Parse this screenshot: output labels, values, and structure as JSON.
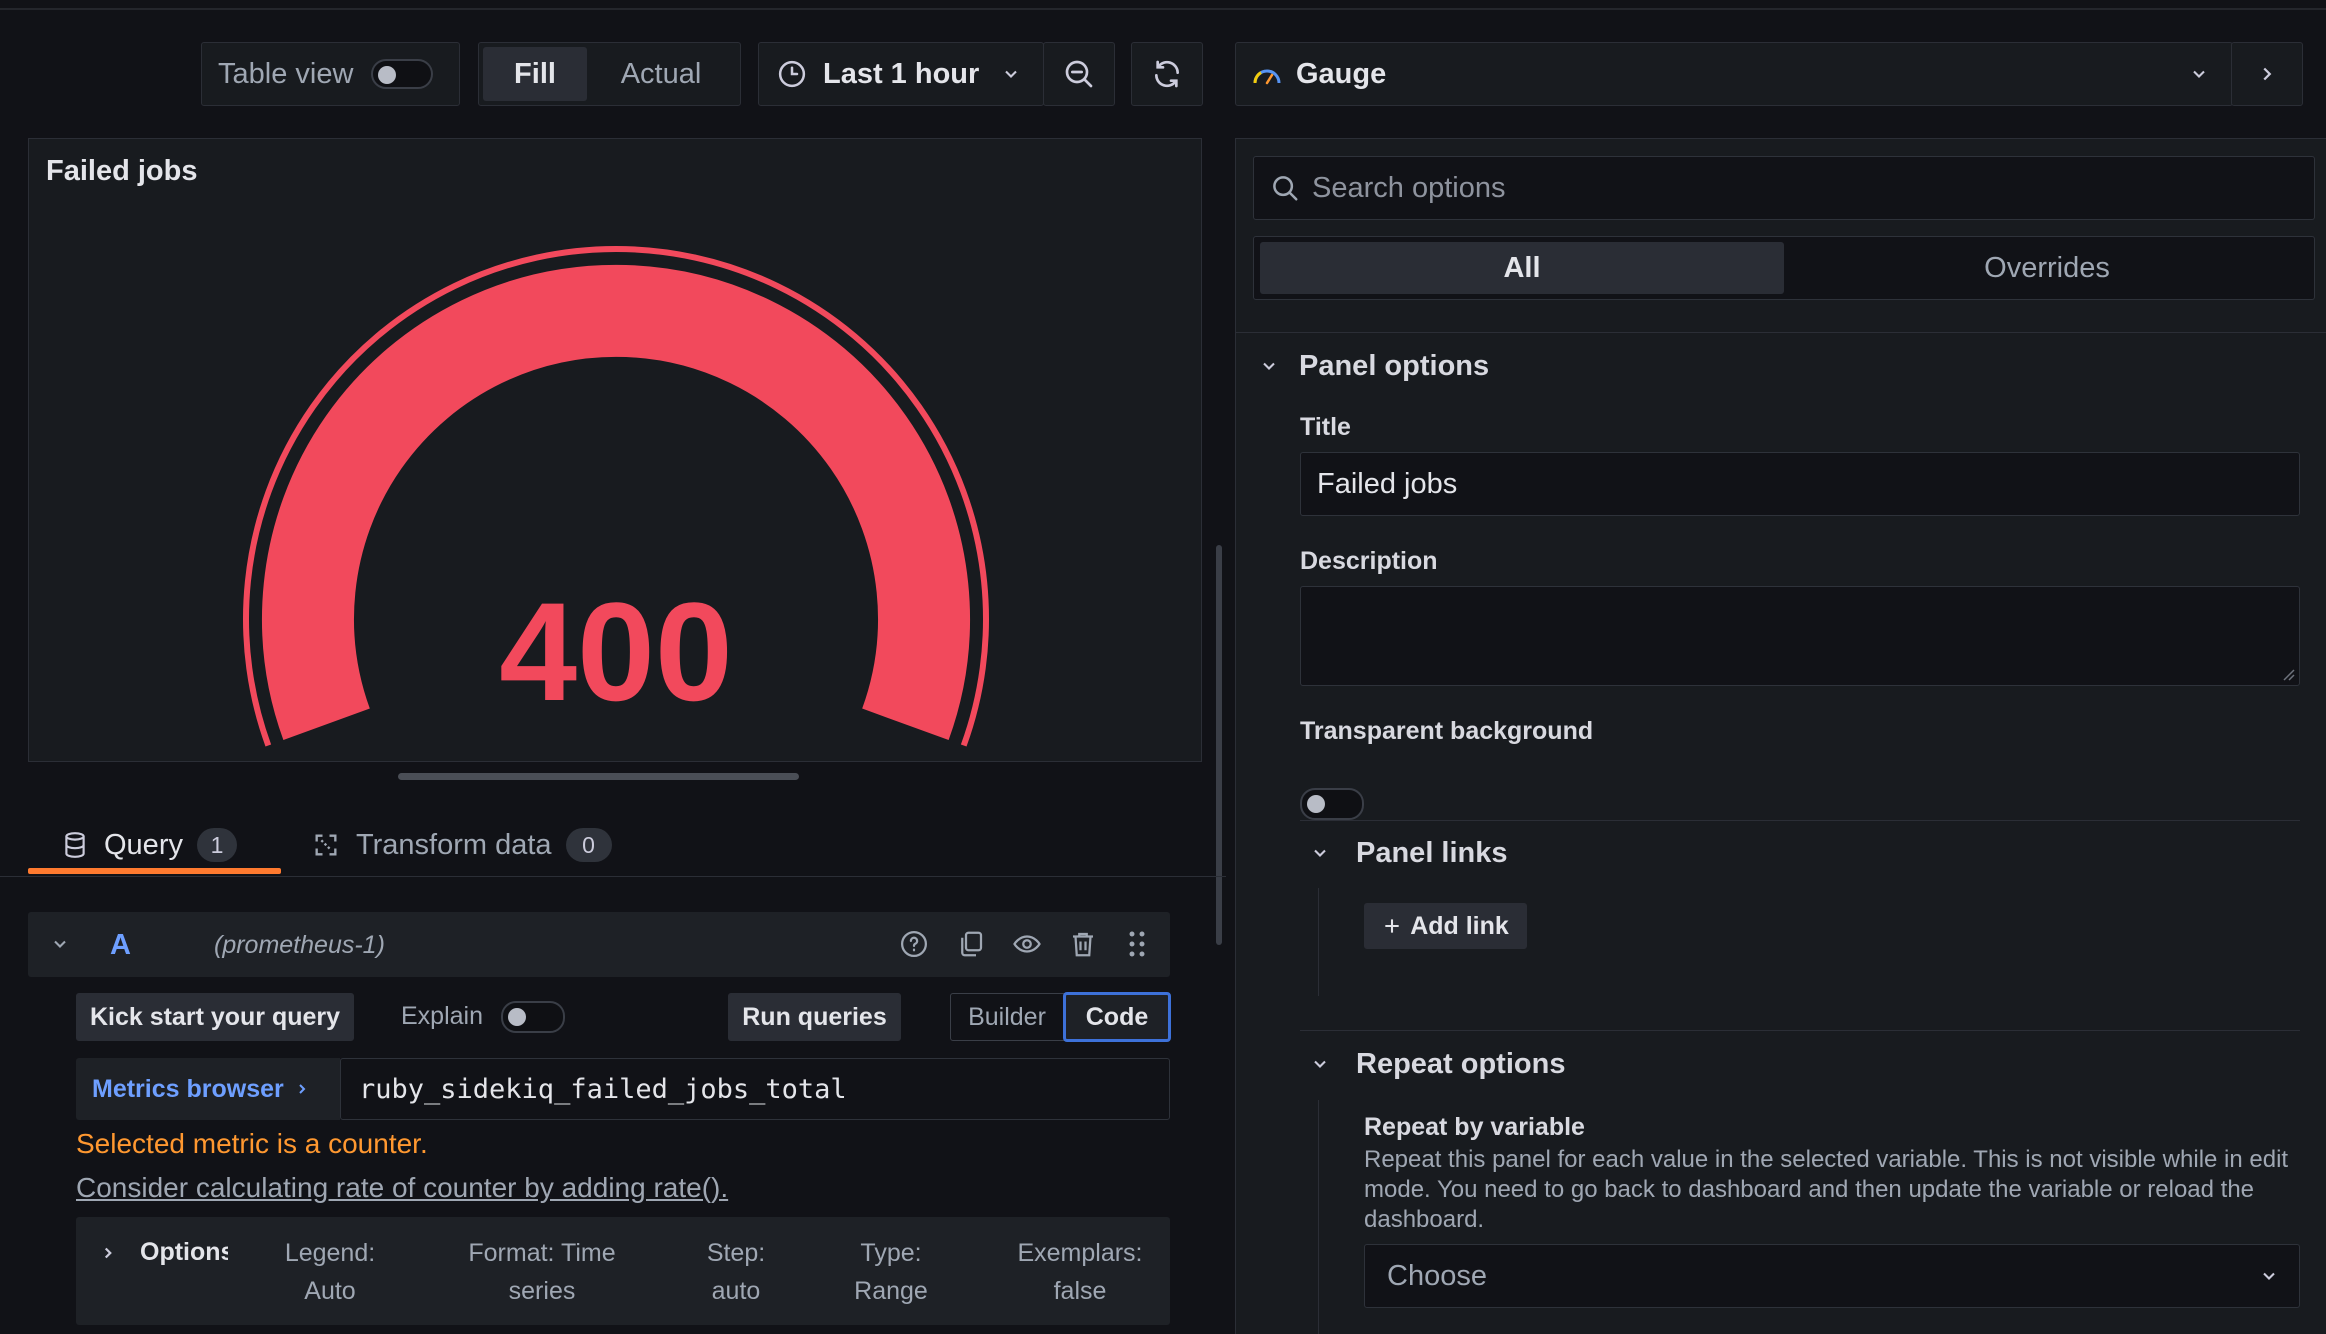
{
  "toolbar": {
    "table_view_label": "Table view",
    "fill_label": "Fill",
    "actual_label": "Actual",
    "time_range_label": "Last 1 hour",
    "visualization_label": "Gauge"
  },
  "panel": {
    "title": "Failed jobs",
    "value": "400",
    "gauge_color": "#f2495c",
    "gauge": {
      "value": 400,
      "min": 0,
      "max": 400
    }
  },
  "tabs": [
    {
      "label": "Query",
      "count": "1"
    },
    {
      "label": "Transform data",
      "count": "0"
    }
  ],
  "query": {
    "ref_id": "A",
    "datasource": "(prometheus-1)",
    "kick_start_label": "Kick start your query",
    "explain_label": "Explain",
    "run_queries_label": "Run queries",
    "builder_label": "Builder",
    "code_label": "Code",
    "metrics_browser_label": "Metrics browser",
    "expression": "ruby_sidekiq_failed_jobs_total",
    "warning_text": "Selected metric is a counter.",
    "hint_link": "Consider calculating rate of counter by adding rate().",
    "options": {
      "label": "Options",
      "legend": [
        "Legend:",
        "Auto"
      ],
      "format": [
        "Format: Time",
        "series"
      ],
      "step": [
        "Step:",
        "auto"
      ],
      "type": [
        "Type:",
        "Range"
      ],
      "exemplars": [
        "Exemplars:",
        "false"
      ]
    }
  },
  "options_pane": {
    "search_placeholder": "Search options",
    "tab_all": "All",
    "tab_overrides": "Overrides",
    "panel_options_title": "Panel options",
    "title_label": "Title",
    "title_value": "Failed jobs",
    "description_label": "Description",
    "description_value": "",
    "transparent_label": "Transparent background",
    "panel_links_title": "Panel links",
    "add_link_label": "Add link",
    "repeat_options_title": "Repeat options",
    "repeat_by_label": "Repeat by variable",
    "repeat_description": "Repeat this panel for each value in the selected variable. This is not visible while in edit mode. You need to go back to dashboard and then update the variable or reload the dashboard.",
    "choose_placeholder": "Choose"
  },
  "colors": {
    "background": "#111217",
    "panel": "#181b1f",
    "accent_orange": "#ff7a2f",
    "link_blue": "#6e9fff",
    "warning": "#ff9830"
  }
}
